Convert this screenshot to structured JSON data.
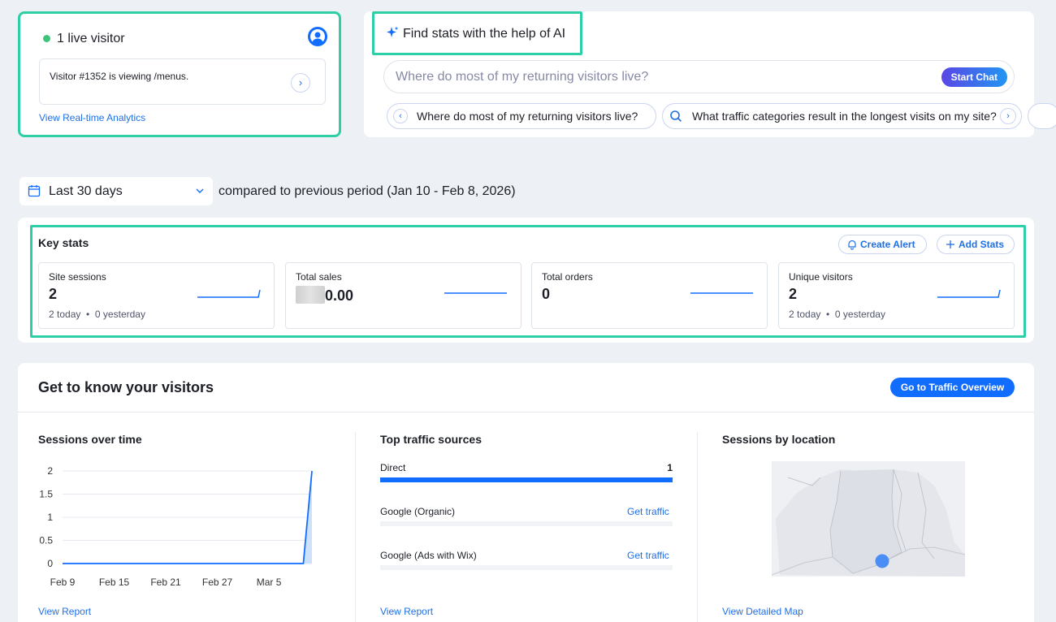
{
  "live": {
    "title": "1 live visitor",
    "message": "Visitor #1352 is viewing /menus.",
    "link": "View Real-time Analytics"
  },
  "ai": {
    "title": "Find stats with the help of AI",
    "placeholder": "Where do most of my returning visitors live?",
    "start_label": "Start Chat",
    "suggestions": [
      "Where do most of my returning visitors live?",
      "What traffic categories result in the longest visits on my site?"
    ]
  },
  "date": {
    "range": "Last 30 days",
    "compare": "compared to previous period (Jan 10 - Feb 8, 2026)"
  },
  "key_stats": {
    "title": "Key stats",
    "create_alert": "Create Alert",
    "add_stats": "Add Stats",
    "cards": [
      {
        "label": "Site sessions",
        "value": "2",
        "today": "2 today",
        "yesterday": "0 yesterday"
      },
      {
        "label": "Total sales",
        "value": "0.00"
      },
      {
        "label": "Total orders",
        "value": "0"
      },
      {
        "label": "Unique visitors",
        "value": "2",
        "today": "2 today",
        "yesterday": "0 yesterday"
      }
    ]
  },
  "visitors": {
    "title": "Get to know your visitors",
    "traffic_button": "Go to Traffic Overview",
    "sessions_title": "Sessions over time",
    "traffic_title": "Top traffic sources",
    "location_title": "Sessions by location",
    "view_report": "View Report",
    "view_report_2": "View Report",
    "view_map": "View Detailed Map",
    "sources": [
      {
        "name": "Direct",
        "value": "1",
        "share": 1.0
      },
      {
        "name": "Google (Organic)",
        "link": "Get traffic",
        "share": 0
      },
      {
        "name": "Google (Ads with Wix)",
        "link": "Get traffic",
        "share": 0
      }
    ]
  },
  "colors": {
    "accent": "#116dff",
    "highlight": "#2ecfa6",
    "live": "#3bc47a"
  },
  "chart_data": {
    "type": "line",
    "title": "Sessions over time",
    "xlabel": "",
    "ylabel": "",
    "x_ticks": [
      "Feb 9",
      "Feb 15",
      "Feb 21",
      "Feb 27",
      "Mar 5"
    ],
    "y_ticks": [
      "2",
      "1.5",
      "1",
      "0.5",
      "0"
    ],
    "ylim": [
      0,
      2
    ],
    "x": [
      "Feb 9",
      "Feb 10",
      "Feb 11",
      "Feb 12",
      "Feb 13",
      "Feb 14",
      "Feb 15",
      "Feb 16",
      "Feb 17",
      "Feb 18",
      "Feb 19",
      "Feb 20",
      "Feb 21",
      "Feb 22",
      "Feb 23",
      "Feb 24",
      "Feb 25",
      "Feb 26",
      "Feb 27",
      "Feb 28",
      "Mar 1",
      "Mar 2",
      "Mar 3",
      "Mar 4",
      "Mar 5",
      "Mar 6",
      "Mar 7",
      "Mar 8",
      "Mar 9",
      "Mar 10"
    ],
    "values": [
      0,
      0,
      0,
      0,
      0,
      0,
      0,
      0,
      0,
      0,
      0,
      0,
      0,
      0,
      0,
      0,
      0,
      0,
      0,
      0,
      0,
      0,
      0,
      0,
      0,
      0,
      0,
      0,
      0,
      2
    ],
    "grid": "horizontal"
  }
}
